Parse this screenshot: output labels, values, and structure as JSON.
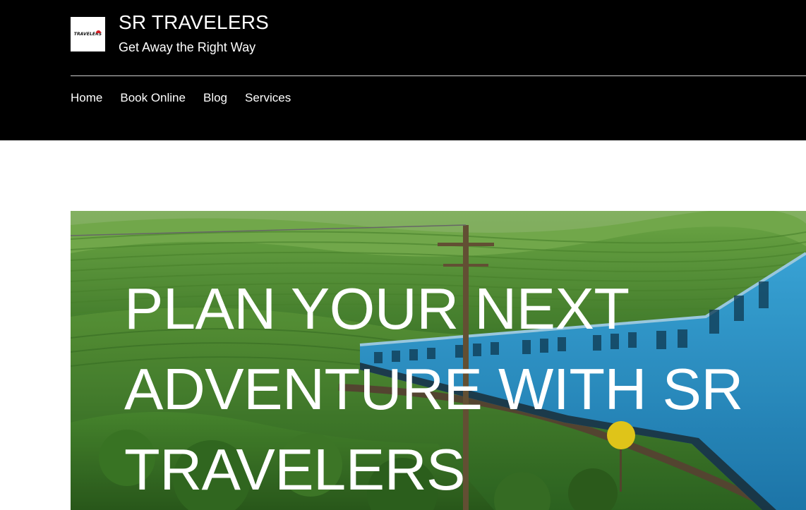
{
  "header": {
    "logo_text": "TRAVELERS",
    "title": "SR TRAVELERS",
    "tagline": "Get Away the Right Way"
  },
  "nav": {
    "items": [
      {
        "label": "Home"
      },
      {
        "label": "Book Online"
      },
      {
        "label": "Blog"
      },
      {
        "label": "Services"
      }
    ]
  },
  "hero": {
    "heading": "PLAN YOUR NEXT ADVENTURE WITH SR TRAVELERS",
    "image": "blue train winding through green tea plantation hills"
  },
  "colors": {
    "header_bg": "#000000",
    "page_bg": "#ffffff",
    "train_blue": "#2e9fd6",
    "logo_accent": "#d81f26"
  }
}
